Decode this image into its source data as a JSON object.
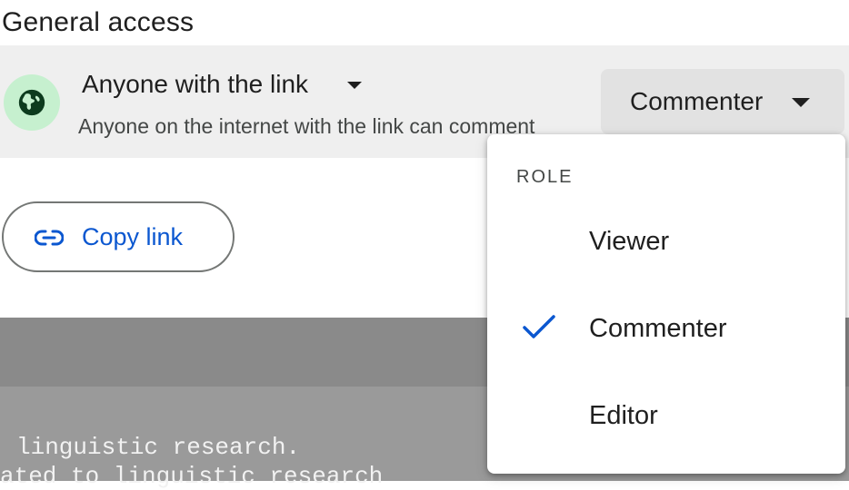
{
  "section": {
    "title": "General access"
  },
  "access": {
    "label": "Anyone with the link",
    "description": "Anyone on the internet with the link can comment",
    "icon": "globe-icon"
  },
  "role_button": {
    "label": "Commenter"
  },
  "copy_link": {
    "label": "Copy link",
    "icon": "link-icon"
  },
  "role_menu": {
    "heading": "ROLE",
    "items": [
      {
        "label": "Viewer",
        "selected": false
      },
      {
        "label": "Commenter",
        "selected": true
      },
      {
        "label": "Editor",
        "selected": false
      }
    ]
  },
  "background_text": {
    "lines": [
      "linguistic research.",
      "ated to linguistic research"
    ]
  },
  "colors": {
    "accent": "#0b57d0",
    "globe_bg": "#c6f0cf",
    "globe_fg": "#0d3b1e",
    "row_bg": "#efefef",
    "button_bg": "#e2e2e2"
  }
}
